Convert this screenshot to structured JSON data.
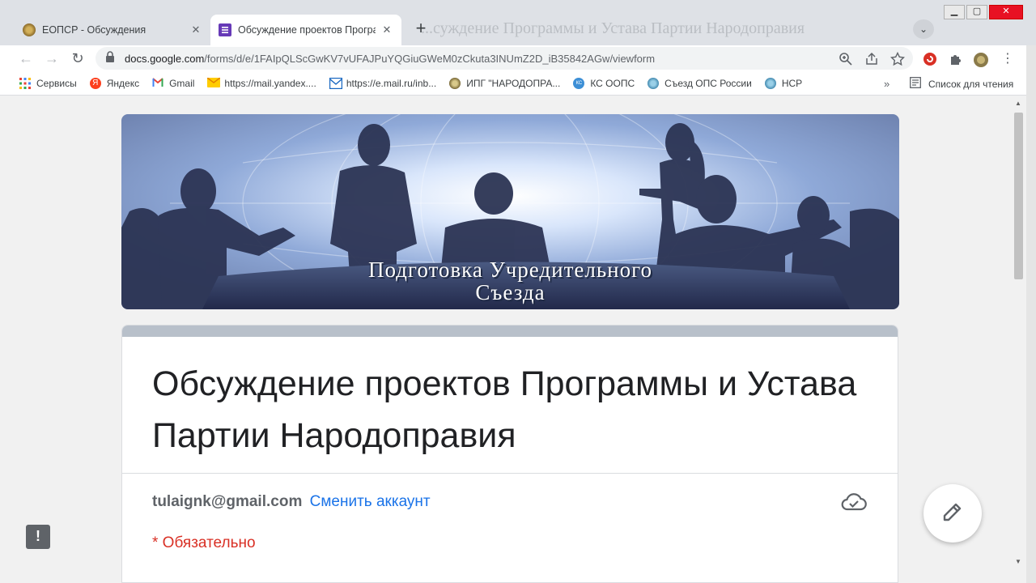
{
  "browser": {
    "tabs": [
      {
        "title": "ЕОПСР - Обсуждения",
        "active": false
      },
      {
        "title": "Обсуждение проектов Програм",
        "active": true
      }
    ],
    "background_title": "...суждение Программы и Устава Партии Народоправия",
    "url_host": "docs.google.com",
    "url_path": "/forms/d/e/1FAIpQLScGwKV7vUFAJPuYQGiuGWeM0zCkuta3INUmZ2D_iB35842AGw/viewform",
    "bookmarks": [
      {
        "label": "Сервисы",
        "icon": "apps-grid-icon"
      },
      {
        "label": "Яндекс",
        "icon": "yandex-icon"
      },
      {
        "label": "Gmail",
        "icon": "gmail-icon"
      },
      {
        "label": "https://mail.yandex....",
        "icon": "mail-envelope-icon"
      },
      {
        "label": "https://e.mail.ru/inb...",
        "icon": "mailru-icon"
      },
      {
        "label": "ИПГ \"НАРОДОПРА...",
        "icon": "emblem-icon"
      },
      {
        "label": "КС ООПС",
        "icon": "ks-icon"
      },
      {
        "label": "Съезд ОПС России",
        "icon": "globe-icon"
      },
      {
        "label": "НСР",
        "icon": "globe-icon"
      }
    ],
    "more_bookmarks": "»",
    "reading_list": "Список для чтения"
  },
  "banner": {
    "line1": "Подготовка Учредительного",
    "line2": "Съезда"
  },
  "form": {
    "title": "Обсуждение проектов Программы и Устава Партии Народоправия",
    "account_email": "tulaignk@gmail.com",
    "switch_account": "Сменить аккаунт",
    "required_note": "* Обязательно"
  },
  "colors": {
    "accent": "#1a73e8",
    "required": "#d93025",
    "stripe": "#b8c0ca"
  }
}
